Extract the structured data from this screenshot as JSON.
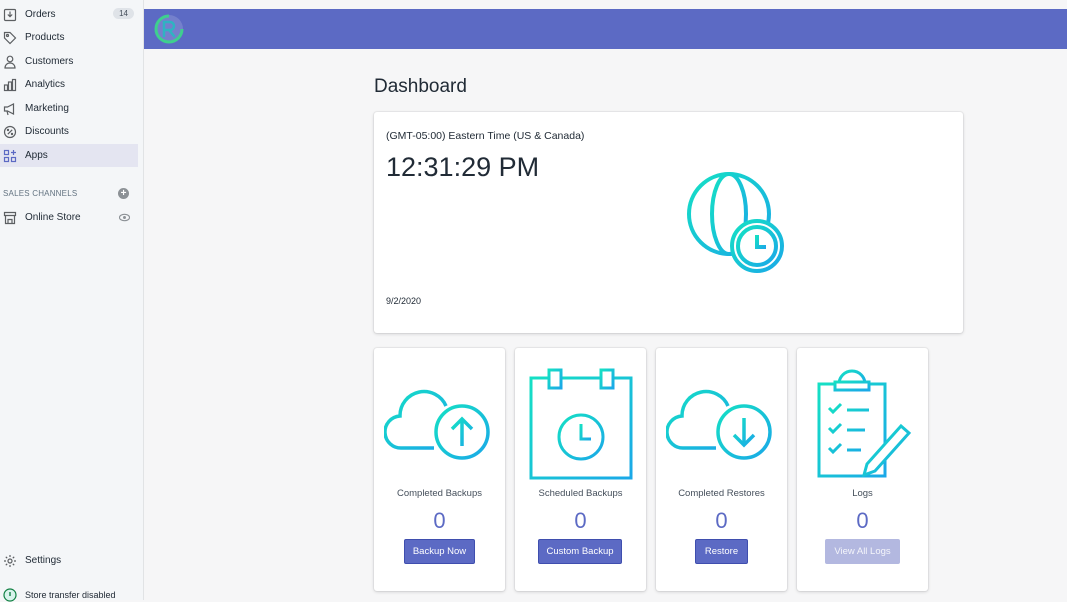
{
  "sidebar": {
    "items": [
      {
        "label": "Orders",
        "icon": "orders-icon",
        "badge": "14"
      },
      {
        "label": "Products",
        "icon": "tag-icon"
      },
      {
        "label": "Customers",
        "icon": "person-icon"
      },
      {
        "label": "Analytics",
        "icon": "bar-chart-icon"
      },
      {
        "label": "Marketing",
        "icon": "megaphone-icon"
      },
      {
        "label": "Discounts",
        "icon": "discount-icon"
      },
      {
        "label": "Apps",
        "icon": "apps-icon",
        "active": true
      }
    ],
    "sales_channels_title": "SALES CHANNELS",
    "online_store": "Online Store",
    "settings": "Settings",
    "store_transfer": "Store transfer disabled"
  },
  "topbar": {
    "color": "#5c6ac4"
  },
  "dashboard": {
    "title": "Dashboard",
    "timezone": "(GMT-05:00) Eastern Time (US & Canada)",
    "time": "12:31:29 PM",
    "date": "9/2/2020"
  },
  "stats": [
    {
      "label": "Completed Backups",
      "value": "0",
      "button": "Backup Now",
      "enabled": true
    },
    {
      "label": "Scheduled Backups",
      "value": "0",
      "button": "Custom Backup",
      "enabled": true
    },
    {
      "label": "Completed Restores",
      "value": "0",
      "button": "Restore",
      "enabled": true
    },
    {
      "label": "Logs",
      "value": "0",
      "button": "View All Logs",
      "enabled": false
    }
  ]
}
